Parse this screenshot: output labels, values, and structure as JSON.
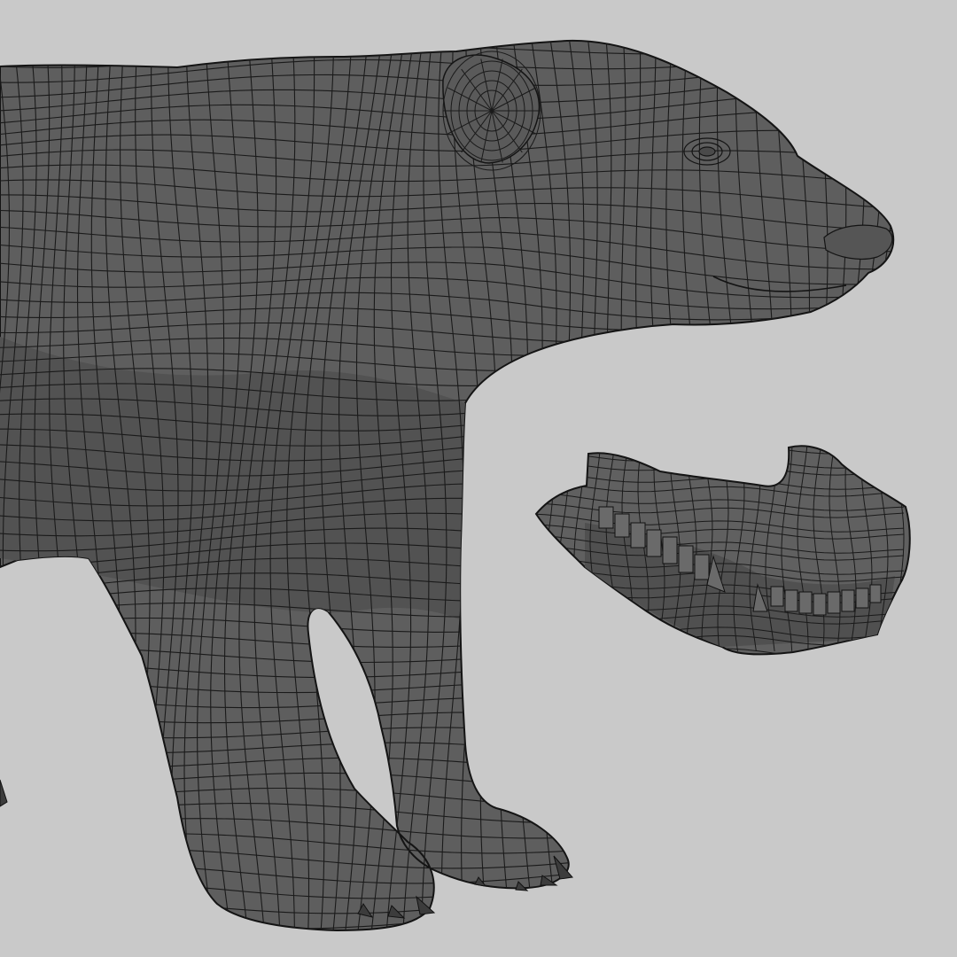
{
  "scene": {
    "background_color": "#c9c9c9",
    "mesh_fill_color": "#5e5e5e",
    "mesh_shadow_color": "#4e4e4e",
    "wire_color": "#151515",
    "objects": [
      {
        "name": "bear-body-mesh",
        "kind": "quad-topology wireframe on shaded surface"
      },
      {
        "name": "jaw-teeth-mesh",
        "kind": "separate jaw and teeth model"
      }
    ]
  }
}
